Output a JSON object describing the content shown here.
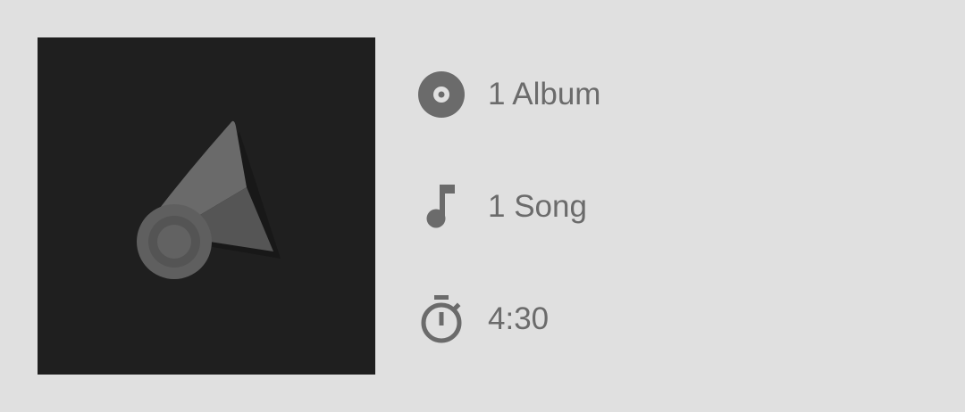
{
  "artist_stats": {
    "albums_label": "1 Album",
    "songs_label": "1 Song",
    "duration_label": "4:30"
  },
  "icons": {
    "album": "album-disc-icon",
    "song": "music-note-icon",
    "duration": "stopwatch-icon",
    "artwork": "gramophone-horn-logo"
  },
  "colors": {
    "background": "#e0e0e0",
    "artwork_background": "#1f1f1f",
    "icon_and_text": "#6b6b6b"
  }
}
